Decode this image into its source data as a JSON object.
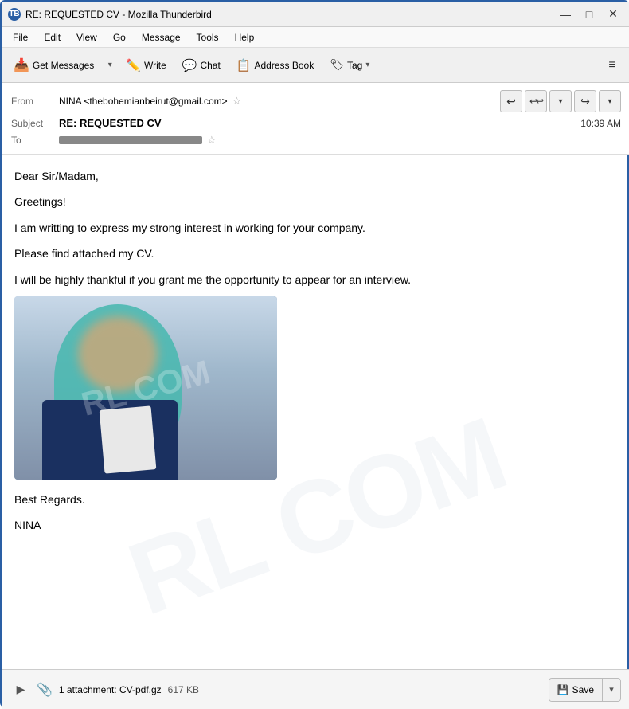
{
  "window": {
    "title": "RE: REQUESTED CV - Mozilla Thunderbird",
    "icon": "TB"
  },
  "titlebar": {
    "minimize": "—",
    "maximize": "□",
    "close": "✕"
  },
  "menubar": {
    "items": [
      "File",
      "Edit",
      "View",
      "Go",
      "Message",
      "Tools",
      "Help"
    ]
  },
  "toolbar": {
    "get_messages": "Get Messages",
    "write": "Write",
    "chat": "Chat",
    "address_book": "Address Book",
    "tag": "Tag",
    "tag_dropdown": "∨"
  },
  "email": {
    "from_label": "From",
    "from_value": "NINA <thebohemianbeirut@gmail.com>",
    "star": "☆",
    "subject_label": "Subject",
    "subject_value": "RE: REQUESTED CV",
    "time": "10:39 AM",
    "to_label": "To",
    "to_value": "[redacted]"
  },
  "reply_buttons": {
    "reply": "↩",
    "reply_all": "↩↩",
    "down": "∨",
    "forward": "→",
    "more": "∨"
  },
  "body": {
    "line1": "Dear Sir/Madam,",
    "line2": "Greetings!",
    "line3": "I am writting to express my strong interest in working for your company.",
    "line4": "Please find attached my CV.",
    "line5": "I will be highly thankful if you grant me the opportunity to appear for an interview.",
    "sign1": "Best Regards.",
    "sign2": "NINA"
  },
  "attachment": {
    "count": "1 attachment: CV-pdf.gz",
    "size": "617 KB",
    "save_label": "Save",
    "save_icon": "💾"
  }
}
